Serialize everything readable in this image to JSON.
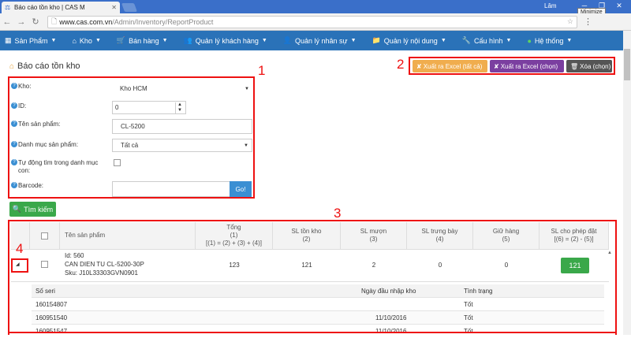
{
  "browser": {
    "tab_title": "Báo cáo tồn kho | CAS M",
    "user": "Lâm",
    "tooltip": "Minimize",
    "url_host": "www.cas.com.vn",
    "url_path": "/Admin/Inventory/ReportProduct"
  },
  "navbar": {
    "items": [
      {
        "icon": "grid-icon",
        "label": "Sản Phẩm"
      },
      {
        "icon": "home-icon",
        "label": "Kho"
      },
      {
        "icon": "cart-icon",
        "label": "Bán hàng"
      },
      {
        "icon": "users-icon",
        "label": "Quản lý khách hàng"
      },
      {
        "icon": "user-icon",
        "label": "Quản lý nhân sự"
      },
      {
        "icon": "folder-icon",
        "label": "Quản lý nội dung"
      },
      {
        "icon": "wrench-icon",
        "label": "Cấu hình"
      },
      {
        "icon": "globe-icon",
        "label": "Hệ thống"
      }
    ]
  },
  "page": {
    "title": "Báo cáo tồn kho"
  },
  "annotations": {
    "n1": "1",
    "n2": "2",
    "n3": "3",
    "n4": "4"
  },
  "actions": {
    "export_all": "Xuất ra Excel (tất cả)",
    "export_selected": "Xuất ra Excel (chọn)",
    "delete_selected": "Xóa (chọn)",
    "colors": {
      "export_all": "#f0ad4e",
      "export_selected": "#7b3fa0",
      "delete": "#555555"
    }
  },
  "form": {
    "kho_label": "Kho:",
    "kho_value": "Kho HCM",
    "id_label": "ID:",
    "id_value": "0",
    "name_label": "Tên sản phẩm:",
    "name_value": "CL-5200",
    "category_label": "Danh mục sản phẩm:",
    "category_value": "Tất cả",
    "auto_label": "Tự động tìm trong danh mục con:",
    "barcode_label": "Barcode:",
    "barcode_value": "",
    "go_button": "Go!",
    "search_button": "Tìm kiếm"
  },
  "table": {
    "headers": {
      "name": "Tên sản phẩm",
      "total": "Tổng\n(1)\n[(1) = (2) + (3) + (4)]",
      "stock": "SL tồn kho\n(2)",
      "borrow": "SL mượn\n(3)",
      "display": "SL trưng bày\n(4)",
      "hold": "Giữ hàng\n(5)",
      "allowed": "SL cho phép đặt\n[(6) = (2) - (5)]"
    },
    "row": {
      "id": "Id: 560",
      "name": "CAN DIEN TU CL-5200-30P",
      "sku": "Sku: J10L33303GVN0901",
      "total": "123",
      "stock": "121",
      "borrow": "2",
      "display": "0",
      "hold": "0",
      "allowed": "121"
    },
    "sub_headers": {
      "serial": "Số seri",
      "date": "Ngày đầu nhập kho",
      "status": "Tình trạng"
    },
    "sub_rows": [
      {
        "serial": "160154807",
        "date": "",
        "status": "Tốt"
      },
      {
        "serial": "160951540",
        "date": "11/10/2016",
        "status": "Tốt"
      },
      {
        "serial": "160951547",
        "date": "11/10/2016",
        "status": "Tốt"
      }
    ]
  }
}
